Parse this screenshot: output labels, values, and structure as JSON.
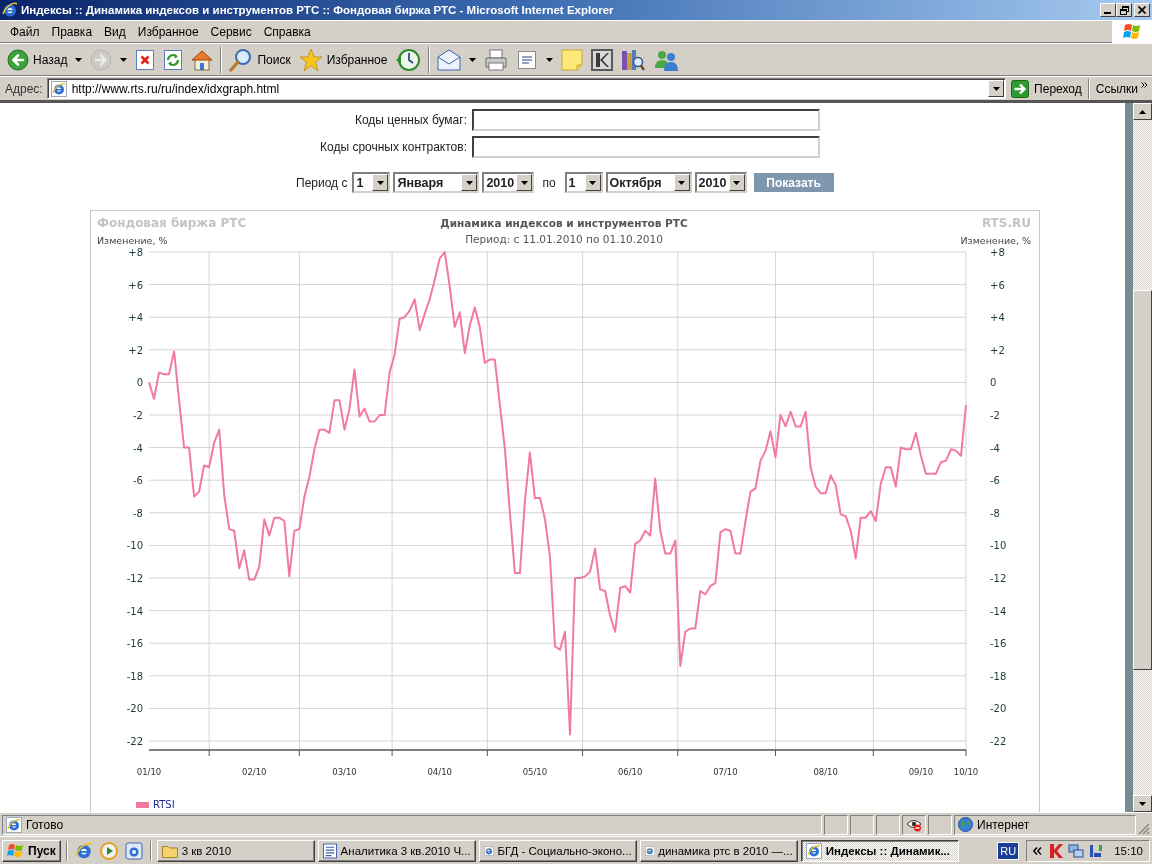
{
  "window": {
    "title": "Индексы :: Динамика индексов и инструментов РТС :: Фондовая биржа РТС - Microsoft Internet Explorer"
  },
  "menu_bar": {
    "items": [
      "Файл",
      "Правка",
      "Вид",
      "Избранное",
      "Сервис",
      "Справка"
    ]
  },
  "toolbar": {
    "groups": [
      [
        {
          "kind": "back",
          "label": "Назад",
          "dropdown": true,
          "disabled": false
        },
        {
          "kind": "forward",
          "dropdown": true,
          "disabled": true
        },
        {
          "kind": "stop",
          "dropdown": false,
          "disabled": false
        },
        {
          "kind": "refresh",
          "dropdown": false,
          "disabled": false
        },
        {
          "kind": "home",
          "dropdown": false,
          "disabled": false
        }
      ],
      [
        {
          "kind": "search",
          "label": "Поиск",
          "dropdown": false,
          "disabled": false
        },
        {
          "kind": "favorites",
          "label": "Избранное",
          "dropdown": false,
          "disabled": false
        },
        {
          "kind": "history",
          "dropdown": false,
          "disabled": false
        }
      ],
      [
        {
          "kind": "mail",
          "dropdown": true,
          "disabled": false
        },
        {
          "kind": "print",
          "dropdown": false,
          "disabled": false
        },
        {
          "kind": "edit",
          "dropdown": true,
          "disabled": false
        },
        {
          "kind": "note",
          "dropdown": false,
          "disabled": false
        },
        {
          "kind": "tile",
          "dropdown": false,
          "disabled": false
        },
        {
          "kind": "research",
          "dropdown": false,
          "disabled": false
        },
        {
          "kind": "messenger",
          "dropdown": false,
          "disabled": false
        }
      ]
    ]
  },
  "address_bar": {
    "label": "Адрес:",
    "url": "http://www.rts.ru/ru/index/idxgraph.html",
    "go": "Переход",
    "links": "Ссылки"
  },
  "form": {
    "fields": [
      {
        "label": "Коды ценных бумаг:"
      },
      {
        "label": "Коды срочных контрактов:"
      }
    ]
  },
  "period": {
    "label": "Период с",
    "from": {
      "day": "1",
      "month": "Января",
      "year": "2010"
    },
    "joiner": "по",
    "to": {
      "day": "1",
      "month": "Октября",
      "year": "2010"
    },
    "button": "Показать"
  },
  "chart": {
    "brand_left": "Фондовая биржа РТС",
    "brand_right": "RTS.RU",
    "subtitle": "Период: с 11.01.2010 по 01.10.2010",
    "ylabel_right": "Изменение, %",
    "right_axis_labels": [
      "+8",
      "+6",
      "+4",
      "+2",
      "0",
      "-2",
      "-4",
      "-6",
      "-8",
      "-10",
      "-12",
      "-14",
      "-16",
      "-18",
      "-20",
      "-22"
    ],
    "chart_data": {
      "type": "line",
      "title": "Динамика индексов и инструментов РТС",
      "ylabel": "Изменение, %",
      "grid": true,
      "categories": [
        "01/10",
        null,
        null,
        null,
        null,
        null,
        null,
        null,
        null,
        null,
        null,
        null,
        null,
        null,
        null,
        null,
        null,
        null,
        null,
        null,
        null,
        "02/10",
        null,
        null,
        null,
        null,
        null,
        null,
        null,
        null,
        null,
        null,
        null,
        null,
        null,
        null,
        null,
        null,
        null,
        "03/10",
        null,
        null,
        null,
        null,
        null,
        null,
        null,
        null,
        null,
        null,
        null,
        null,
        null,
        null,
        null,
        null,
        null,
        null,
        "04/10",
        null,
        null,
        null,
        null,
        null,
        null,
        null,
        null,
        null,
        null,
        null,
        null,
        null,
        null,
        null,
        null,
        null,
        null,
        "05/10",
        null,
        null,
        null,
        null,
        null,
        null,
        null,
        null,
        null,
        null,
        null,
        null,
        null,
        null,
        null,
        null,
        null,
        null,
        "06/10",
        null,
        null,
        null,
        null,
        null,
        null,
        null,
        null,
        null,
        null,
        null,
        null,
        null,
        null,
        null,
        null,
        null,
        null,
        "07/10",
        null,
        null,
        null,
        null,
        null,
        null,
        null,
        null,
        null,
        null,
        null,
        null,
        null,
        null,
        null,
        null,
        null,
        null,
        null,
        "08/10",
        null,
        null,
        null,
        null,
        null,
        null,
        null,
        null,
        null,
        null,
        null,
        null,
        null,
        null,
        null,
        null,
        null,
        null,
        "09/10",
        null,
        null,
        null,
        null,
        null,
        null,
        null,
        null,
        "10/10"
      ],
      "series": [
        {
          "name": "RTSI",
          "color": "#f27aa0",
          "values": [
            0.0,
            -1.0,
            0.6,
            0.5,
            0.5,
            1.9,
            -1.1,
            -4.0,
            -4.0,
            -7.0,
            -6.7,
            -5.1,
            -5.2,
            -3.7,
            -2.9,
            -6.9,
            -9.0,
            -9.1,
            -11.4,
            -10.3,
            -12.1,
            -12.1,
            -11.3,
            -8.4,
            -9.4,
            -8.3,
            -8.3,
            -8.5,
            -11.9,
            -9.1,
            -9.0,
            -7.0,
            -5.8,
            -4.1,
            -2.9,
            -2.9,
            -3.1,
            -1.1,
            -1.1,
            -2.9,
            -1.6,
            0.8,
            -2.1,
            -1.6,
            -2.4,
            -2.4,
            -2.0,
            -2.0,
            0.6,
            1.7,
            3.9,
            4.0,
            4.4,
            5.1,
            3.2,
            4.2,
            5.1,
            6.3,
            7.6,
            8.0,
            5.9,
            3.4,
            4.3,
            1.8,
            3.5,
            4.6,
            3.4,
            1.2,
            1.4,
            1.4,
            -1.4,
            -4.1,
            -8.0,
            -11.7,
            -11.7,
            -7.3,
            -4.3,
            -7.1,
            -7.1,
            -8.4,
            -10.7,
            -16.2,
            -16.4,
            -15.3,
            -21.6,
            -12.0,
            -12.0,
            -11.9,
            -11.6,
            -10.2,
            -12.7,
            -12.8,
            -14.3,
            -15.3,
            -12.6,
            -12.5,
            -12.9,
            -9.9,
            -9.7,
            -9.1,
            -9.4,
            -5.9,
            -9.1,
            -10.5,
            -10.5,
            -9.7,
            -17.4,
            -15.3,
            -15.1,
            -15.1,
            -12.8,
            -13.0,
            -12.5,
            -12.3,
            -9.2,
            -9.0,
            -9.1,
            -10.5,
            -10.5,
            -8.5,
            -6.7,
            -6.5,
            -4.8,
            -4.2,
            -3.0,
            -4.6,
            -2.0,
            -2.7,
            -1.8,
            -2.7,
            -2.7,
            -1.8,
            -5.2,
            -6.4,
            -6.8,
            -6.8,
            -5.7,
            -6.3,
            -8.1,
            -8.2,
            -9.1,
            -10.8,
            -8.3,
            -8.3,
            -7.9,
            -8.5,
            -6.2,
            -5.2,
            -5.2,
            -6.4,
            -4.0,
            -4.1,
            -4.1,
            -3.1,
            -4.5,
            -5.6,
            -5.6,
            -5.6,
            -4.9,
            -4.8,
            -4.1,
            -4.2,
            -4.5,
            -1.4
          ]
        }
      ],
      "ylim": [
        -22,
        8
      ],
      "yticks": [
        {
          "value": 8,
          "label": "+8"
        },
        {
          "value": 6,
          "label": "+6"
        },
        {
          "value": 4,
          "label": "+4"
        },
        {
          "value": 2,
          "label": "+2"
        },
        0,
        -2,
        -4,
        -6,
        -8,
        -10,
        -12,
        -14,
        -16,
        -18,
        -20,
        -22
      ]
    }
  },
  "status_bar": {
    "text": "Готово",
    "zone": "Интернет"
  },
  "taskbar": {
    "start": "Пуск",
    "tasks": [
      {
        "label": "3 кв 2010",
        "kind": "folder",
        "selected": false
      },
      {
        "label": "Аналитика 3 кв.2010 Ч...",
        "kind": "document",
        "selected": false
      },
      {
        "label": "БГД - Социально-эконо...",
        "kind": "browser",
        "selected": false
      },
      {
        "label": "динамика ртс в 2010 —...",
        "kind": "browser",
        "selected": false
      },
      {
        "label": "Индексы :: Динамик...",
        "kind": "browser",
        "selected": true
      }
    ],
    "language": "RU",
    "clock": "15:10"
  }
}
